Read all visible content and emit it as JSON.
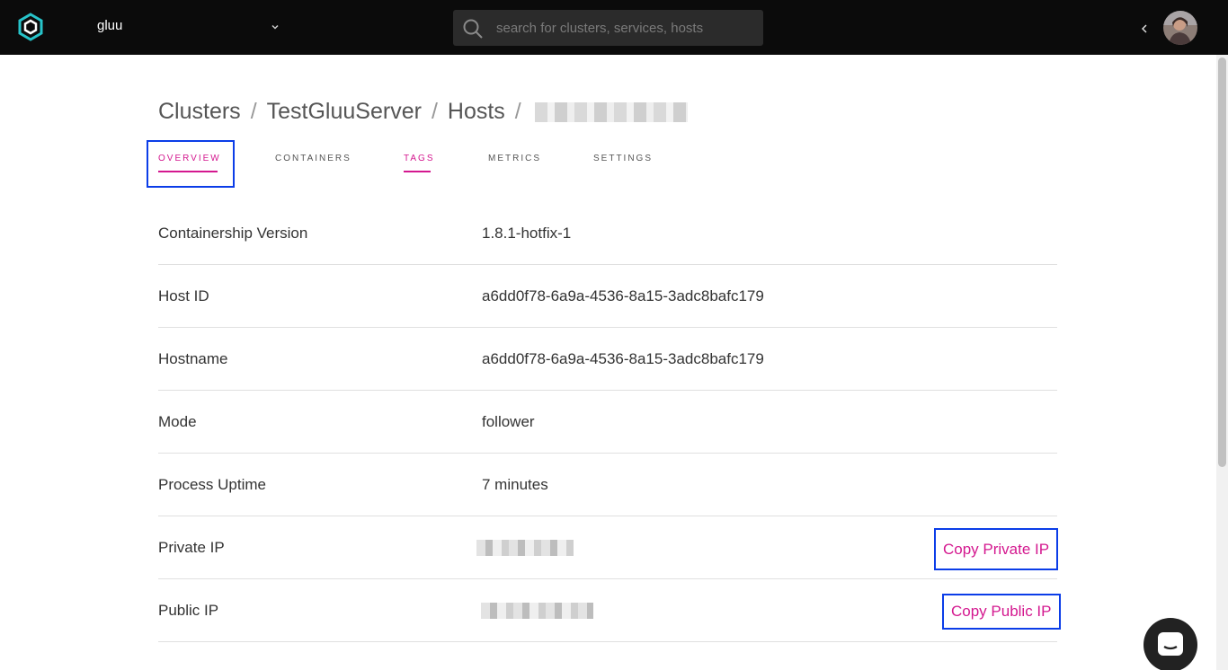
{
  "topbar": {
    "org_name": "gluu",
    "search_placeholder": "search for clusters, services, hosts",
    "logo_icon": "containership-logo-icon",
    "colors": {
      "background": "#0b0b0b",
      "logo": "#27c3c9"
    }
  },
  "breadcrumb": {
    "items": [
      "Clusters",
      "TestGluuServer",
      "Hosts"
    ],
    "separator": "/"
  },
  "tabs": [
    {
      "label": "OVERVIEW",
      "active": true
    },
    {
      "label": "CONTAINERS",
      "active": false
    },
    {
      "label": "TAGS",
      "active": false
    },
    {
      "label": "METRICS",
      "active": false
    },
    {
      "label": "SETTINGS",
      "active": false
    }
  ],
  "details": [
    {
      "label": "Containership Version",
      "value": "1.8.1-hotfix-1"
    },
    {
      "label": "Host ID",
      "value": "a6dd0f78-6a9a-4536-8a15-3adc8bafc179"
    },
    {
      "label": "Hostname",
      "value": "a6dd0f78-6a9a-4536-8a15-3adc8bafc179"
    },
    {
      "label": "Mode",
      "value": "follower"
    },
    {
      "label": "Process Uptime",
      "value": "7 minutes"
    },
    {
      "label": "Private IP",
      "action": "Copy Private IP"
    },
    {
      "label": "Public IP",
      "action": "Copy Public IP"
    }
  ],
  "colors": {
    "accent": "#d4188f",
    "focus": "#0b3de8"
  }
}
